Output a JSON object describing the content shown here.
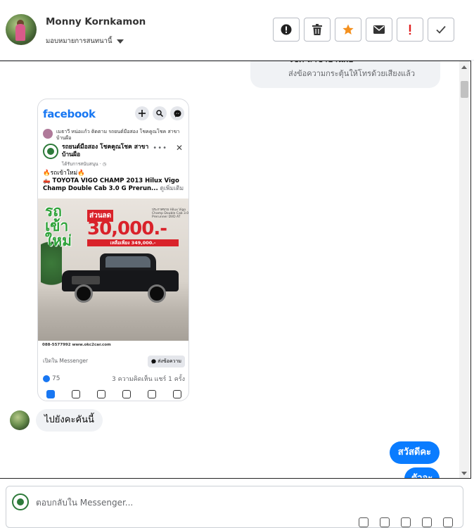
{
  "header": {
    "user_name": "Monny Kornkamon",
    "assign_label": "มอบหมายการสนทนานี้",
    "actions": [
      {
        "name": "report-button",
        "icon": "alert-circle-icon"
      },
      {
        "name": "delete-button",
        "icon": "trash-icon"
      },
      {
        "name": "star-button",
        "icon": "star-icon"
      },
      {
        "name": "mark-unread-button",
        "icon": "envelope-icon"
      },
      {
        "name": "mark-spam-button",
        "icon": "exclamation-icon"
      },
      {
        "name": "done-button",
        "icon": "check-icon"
      }
    ],
    "colors": {
      "star": "#f4901e",
      "spam": "#e02020"
    }
  },
  "chat": {
    "top_bubble": {
      "line1": "โชค สาขาบ้านผือ",
      "line2": "ส่งข้อความกระตุ้นให้โทรด้วยเสียงแล้ว"
    },
    "fb_card": {
      "logo": "facebook",
      "shared_by": "เมธาวี หน่อแก้ว ติดตาม รถยนต์มือสอง โชคคูณโชค สาขาบ้านผือ",
      "page_name": "รถยนต์มือสอง โชคคูณโชค สาขา บ้านผือ",
      "page_sub": "ได้รับการสนับสนุน · ◷",
      "post_line1": "🔥รถเข้าใหม่🔥",
      "post_line2": "🛻 TOYOTA VIGO CHAMP 2013 Hilux Vigo Champ Double Cab 3.0 G Prerun...",
      "see_more": "ดูเพิ่มเติม",
      "banner_green": [
        "รถ",
        "เข้า",
        "ใหม่"
      ],
      "banner_red_title": "ส่วนลด",
      "banner_price": "30,000.-",
      "banner_bar": "เหลือเพียง 349,000.-",
      "banner_info": "ประกาศขาย Hilux Vigo Champ Double Cab 3.0 G Prerunner DVD AT",
      "photo_footer": "088-5577992 www.okc2car.com",
      "open_messenger": "เปิดใน Messenger",
      "send_message": "ส่งข้อความ",
      "likes": "75",
      "comments_shares": "3 ความคิดเห็น  แชร์ 1 ครั้ง"
    },
    "received_message": "ไปยังคะคันนี้",
    "sent_message": "สวัสดีคะ",
    "sent_message2": "ตัวอะ"
  },
  "composer": {
    "placeholder": "ตอบกลับใน Messenger..."
  }
}
